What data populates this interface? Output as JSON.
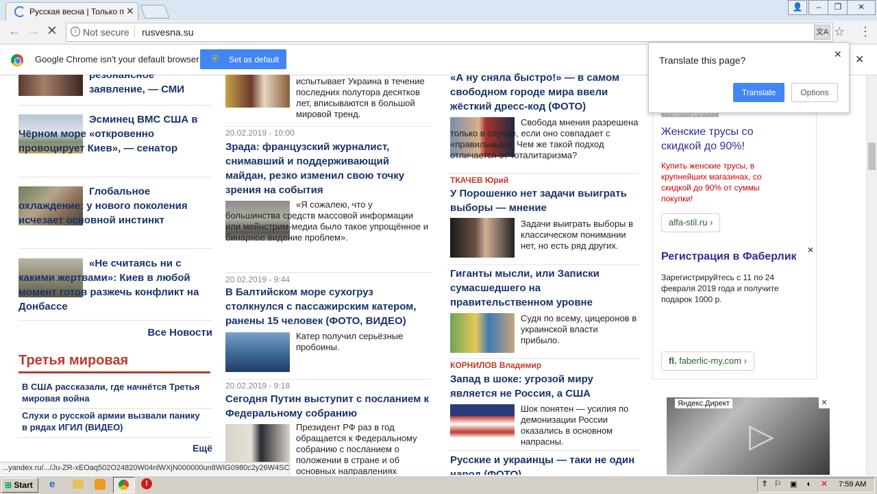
{
  "browser": {
    "tab_title": "Русская весна | Только пр",
    "not_secure": "Not secure",
    "url": "rusvesna.su",
    "infobar_text": "Google Chrome isn't your default browser",
    "set_default": "Set as default",
    "translate_question": "Translate this page?",
    "translate_button": "Translate",
    "options_button": "Options",
    "status_url": "...yandex.ru/.../Ju-ZR-xEOaq502O24820W04nlWXjN000000un8WIG0980c2y26W4SC..."
  },
  "left_col": {
    "item0_title": "резонансное заявление, — СМИ",
    "item1_title": "Эсминец ВМС США в Чёрном море «откровенно провоцирует Киев», — сенатор",
    "item2_title": "Глобальное охлаждение: у нового поколения исчезает основной инстинкт",
    "item3_title": "«Не считаясь ни с какими жертвами»: Киев в любой момент готов разжечь конфликт на Донбассе",
    "all_news": "Все Новости",
    "section_title": "Третья мировая",
    "section_item1": "В США рассказали, где начнётся Третья мировая война",
    "section_item2": "Слухи о русской армии вызвали панику в рядах ИГИЛ (ВИДЕО)",
    "more": "Ещё"
  },
  "middle_col": {
    "item0_text": "испытывает Украина в течение последних полутора десятков лет, вписываются в большой мировой тренд.",
    "item1_date": "20.02.2019 - 10:00",
    "item1_title": "Зрада: французский журналист, снимавший и поддерживающий майдан, резко изменил свою точку зрения на события",
    "item1_text": "«Я сожалею, что у большинства средств массовой информации или мейнстрим-медиа было такое упрощённое и бинарное видение проблем».",
    "item2_date": "20.02.2019 - 9:44",
    "item2_title": "В Балтийском море сухогруз столкнулся с пассажирским катером, ранены 15 человек (ФОТО, ВИДЕО)",
    "item2_text": "Катер получил серьёзные пробоины.",
    "item3_date": "20.02.2019 - 9:18",
    "item3_title": "Сегодня Путин выступит с посланием к Федеральному собранию",
    "item3_text": "Президент РФ раз в год обращается к Федеральному собранию с посланием о положении в стране и об основных направлениях внутренней и внешней политики."
  },
  "right_col": {
    "item0_title": "«А ну сняла быстро!» — в самом свободном городе мира ввели жёсткий дресс-код (ФОТО)",
    "item0_text": "Свобода мнения разрешена только в случае, если оно совпадает с «правильным». Чем же такой подход отличается от тоталитаризма?",
    "item1_author": "ТКАЧЕВ Юрий",
    "item1_title": "У Порошенко нет задачи выиграть выборы — мнение",
    "item1_text": "Задачи выиграть выборы в классическом понимании нет, но есть ряд других.",
    "item2_title": "Гиганты мысли, или Записки сумасшедшего на правительственном уровне",
    "item2_text": "Судя по всему, цицеронов в украинской власти прибыло.",
    "item3_author": "КОРНИЛОВ Владимир",
    "item3_title": "Запад в шоке: угрозой миру является не Россия, а США",
    "item3_text": "Шок понятен — усилия по демонизации России оказались в основном напрасны.",
    "item4_title": "Русские и украинцы — таки не один народ (ФОТО)"
  },
  "ads": {
    "label": "Яндекс.Директ",
    "ad1_title": "Женские трусы со скидкой до 90%!",
    "ad1_text": "Купить женские трусы, в крупнейших магазинах, со скидкой до 90% от суммы покупки!",
    "ad1_link": "alfa-stil.ru",
    "ad2_title": "Регистрация в Фаберлик",
    "ad2_text": "Зарегистрируйтесь с 11 по 24 февраля 2019 года и получите подарок 1000 р.",
    "ad2_link": "faberlic-my.com",
    "video_label": "Яндекс.Директ"
  },
  "taskbar": {
    "start": "Start",
    "clock": "7:59 AM"
  }
}
